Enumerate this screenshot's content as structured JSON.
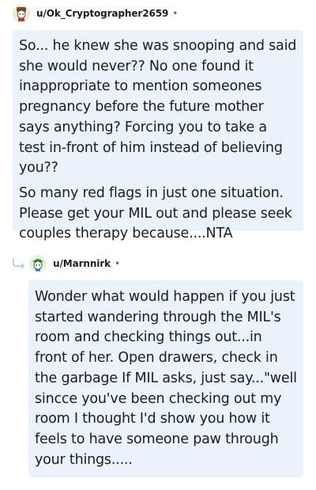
{
  "comments": [
    {
      "username": "u/Ok_Cryptographer2659",
      "separator": "•",
      "paragraphs": [
        "So... he knew she was snooping and said she would never?? No one found it inappropriate to mention someones pregnancy before the future mother says anything? Forcing you to take a test in-front of him instead of believing you??",
        "So many red flags in just one situation. Please get your MIL out and please seek couples therapy because....NTA"
      ]
    },
    {
      "username": "u/Marnnirk",
      "separator": "•",
      "paragraphs": [
        "Wonder what would happen if you just started wandering through the MIL's room and checking things out...in front of her. Open drawers, check in the garbage If MIL asks, just say...\"well sincce you've been checking out my room I thought I'd show you how it feels to have someone paw through your things....."
      ]
    }
  ]
}
